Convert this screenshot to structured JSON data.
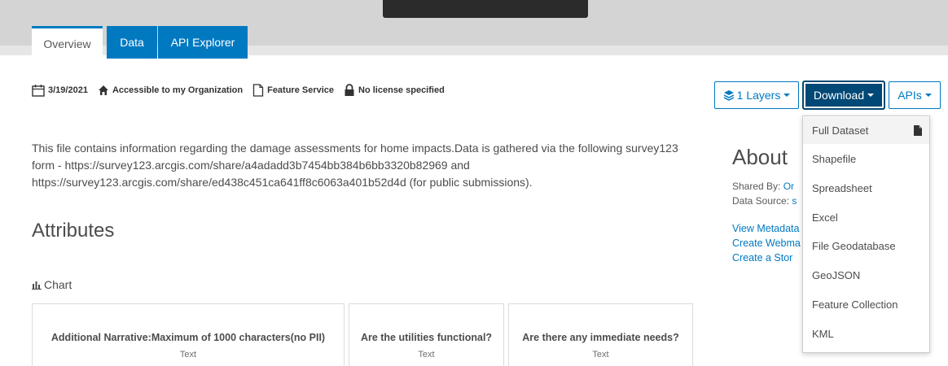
{
  "tabs": [
    {
      "label": "Overview",
      "active": true
    },
    {
      "label": "Data",
      "active": false
    },
    {
      "label": "API Explorer",
      "active": false
    }
  ],
  "meta": {
    "date": "3/19/2021",
    "access": "Accessible to my Organization",
    "type": "Feature Service",
    "license": "No license specified",
    "icons": [
      "calendar-icon",
      "home-icon",
      "file-icon",
      "lock-icon"
    ]
  },
  "toolbar": {
    "layers_label": "1 Layers",
    "download_label": "Download",
    "apis_label": "APIs"
  },
  "description": "This file contains information regarding the damage assessments for home impacts.Data is gathered via the following survey123 form - https://survey123.arcgis.com/share/a4adadd3b7454bb384b6bb3320b82969 and https://survey123.arcgis.com/share/ed438c451ca641ff8c6063a401b52d4d (for public submissions).",
  "attributes": {
    "heading": "Attributes",
    "chart_label": "Chart",
    "cards": [
      {
        "title": "Additional Narrative:Maximum of 1000 characters(no PII)",
        "type": "Text"
      },
      {
        "title": "Are the utilities functional?",
        "type": "Text"
      },
      {
        "title": "Are there any immediate needs?",
        "type": "Text"
      }
    ]
  },
  "about": {
    "heading": "About",
    "shared_by_label": "Shared By: ",
    "shared_by_value": "Or",
    "data_source_label": "Data Source: ",
    "data_source_value": "s",
    "links": [
      "View Metadata",
      "Create Webma",
      "Create a Stor"
    ]
  },
  "download_menu": {
    "items": [
      "Full Dataset",
      "Shapefile",
      "Spreadsheet",
      "Excel",
      "File Geodatabase",
      "GeoJSON",
      "Feature Collection",
      "KML"
    ]
  },
  "colors": {
    "primary": "#0079c1",
    "download_active": "#004875",
    "text": "#4c4c4c"
  }
}
